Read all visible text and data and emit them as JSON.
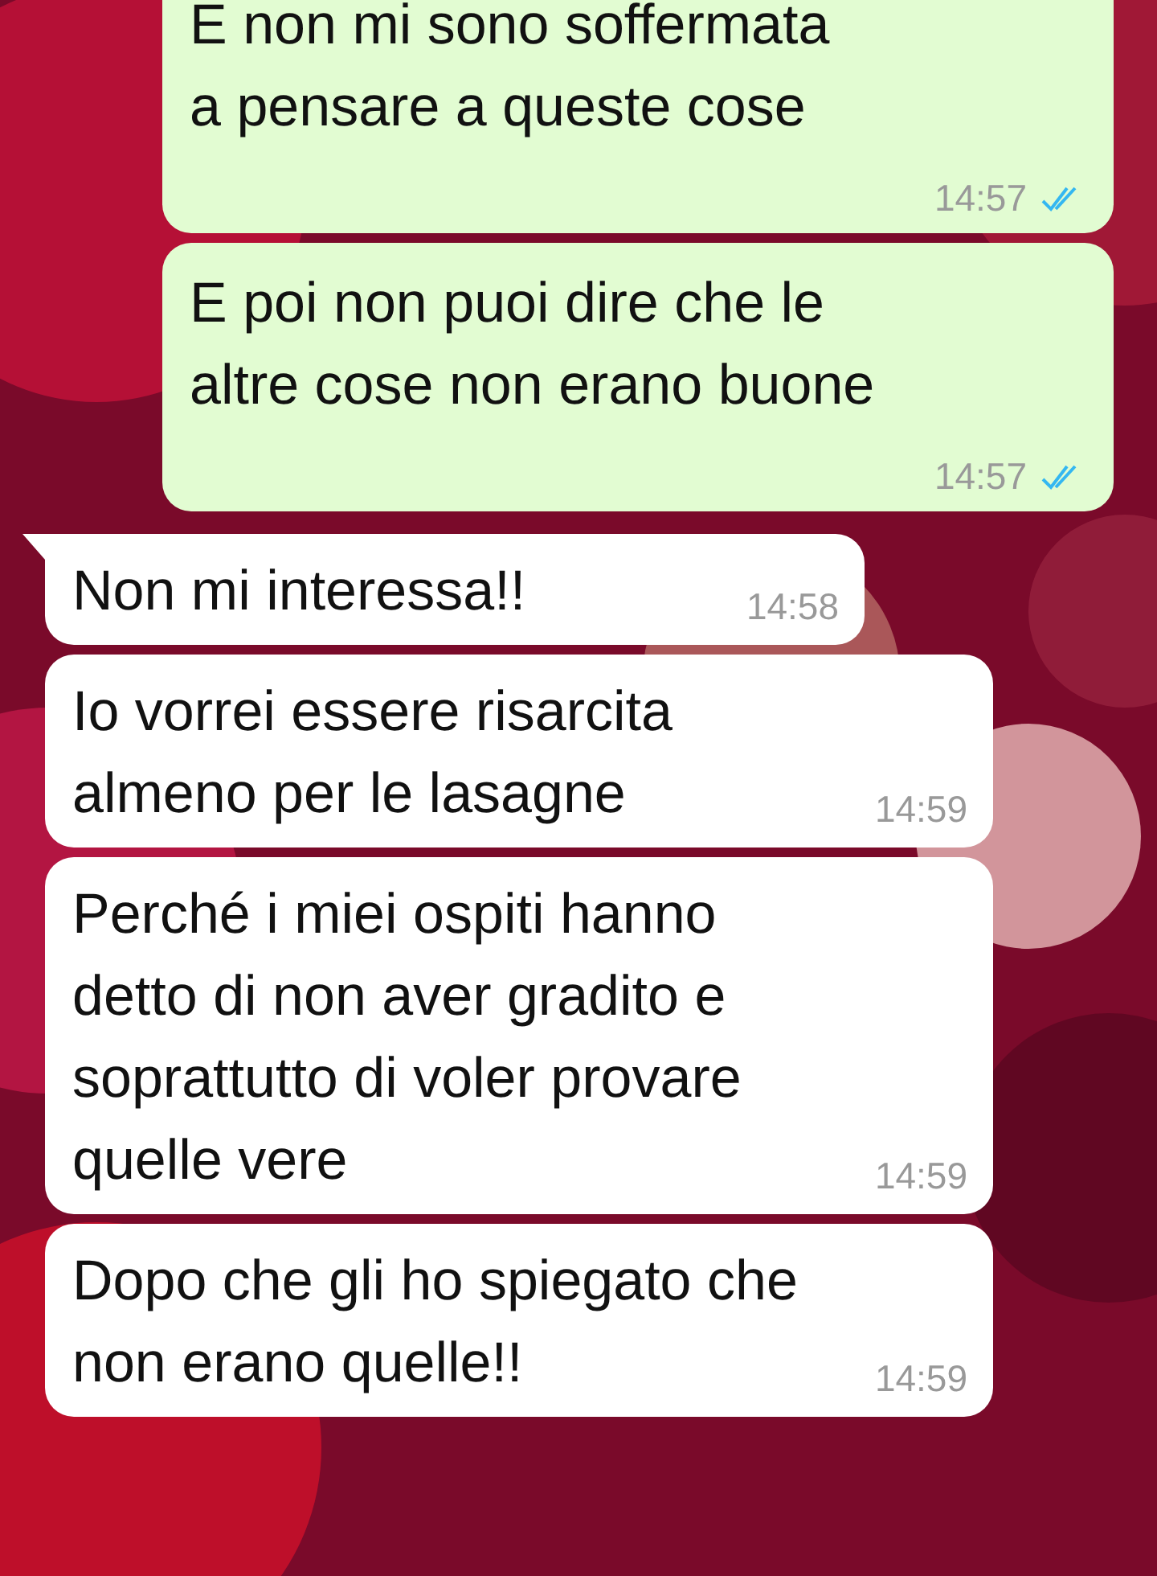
{
  "messages": [
    {
      "kind": "sent",
      "text": "E non mi sono soffermata\na pensare a queste cose",
      "time": "14:57",
      "read": true
    },
    {
      "kind": "sent",
      "text": "E poi non puoi dire che le\naltre cose non erano buone",
      "time": "14:57",
      "read": true
    },
    {
      "kind": "received",
      "text": "Non mi interessa!!",
      "time": "14:58",
      "tail": true
    },
    {
      "kind": "received",
      "text": "Io vorrei essere risarcita\nalmeno per le lasagne",
      "time": "14:59",
      "tail": false
    },
    {
      "kind": "received",
      "text": "Perché i miei ospiti hanno\ndetto di non aver gradito e\nsoprattutto di voler provare\nquelle vere",
      "time": "14:59",
      "tail": false
    },
    {
      "kind": "received",
      "text": "Dopo che gli ho spiegato che\nnon erano quelle!!",
      "time": "14:59",
      "tail": false
    }
  ]
}
